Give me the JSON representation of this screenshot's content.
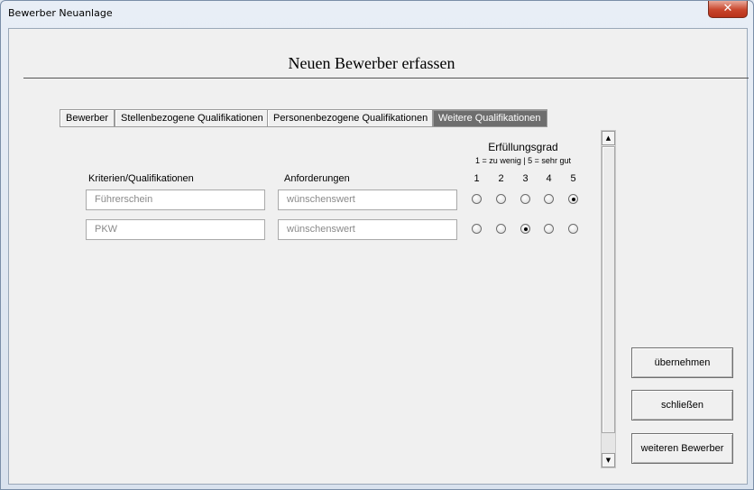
{
  "window": {
    "title": "Bewerber Neuanlage",
    "close_glyph": "✕"
  },
  "heading": "Neuen Bewerber erfassen",
  "tabs": [
    {
      "label": "Bewerber",
      "active": false
    },
    {
      "label": "Stellenbezogene Qualifikationen",
      "active": false
    },
    {
      "label": "Personenbezogene Qualifikationen",
      "active": false
    },
    {
      "label": "Weitere Qualifikationen",
      "active": true
    }
  ],
  "grid": {
    "col_criteria": "Kriterien/Qualifikationen",
    "col_requirements": "Anforderungen",
    "fulfillment_title": "Erfüllungsgrad",
    "fulfillment_scale": "1 = zu wenig | 5 = sehr gut",
    "levels": [
      "1",
      "2",
      "3",
      "4",
      "5"
    ],
    "rows": [
      {
        "criteria_placeholder": "Führerschein",
        "requirement_placeholder": "wünschenswert",
        "selected_level": 5
      },
      {
        "criteria_placeholder": "PKW",
        "requirement_placeholder": "wünschenswert",
        "selected_level": 3
      }
    ]
  },
  "scrollbar": {
    "up_glyph": "▲",
    "down_glyph": "▼"
  },
  "buttons": {
    "apply": "übernehmen",
    "close": "schließen",
    "next": "weiteren Bewerber"
  }
}
